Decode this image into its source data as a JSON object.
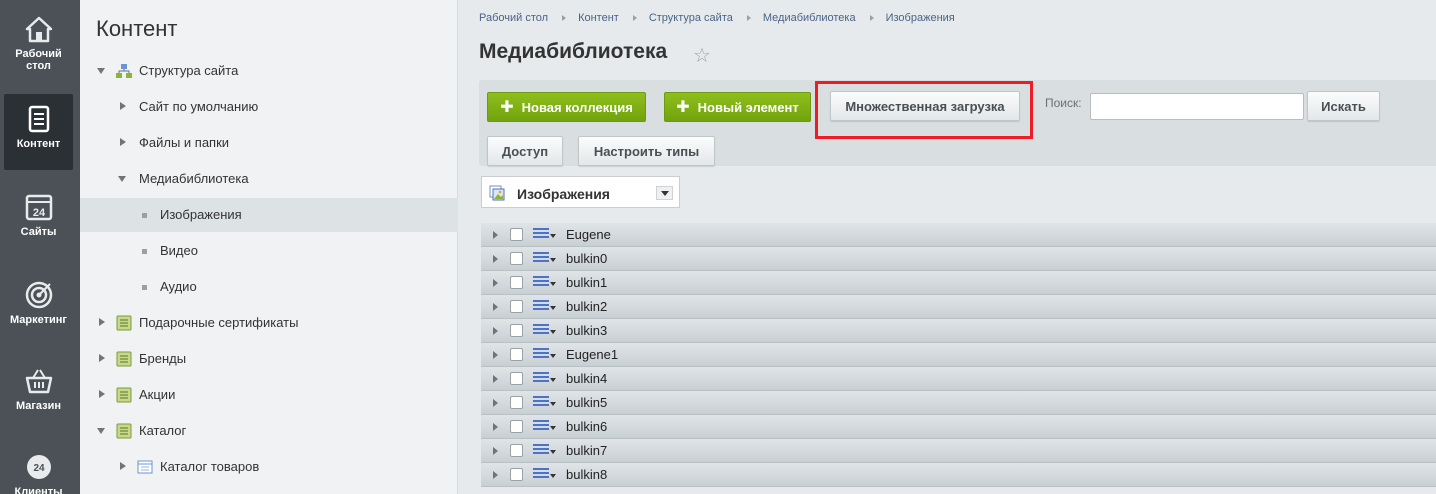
{
  "rail": [
    {
      "label": "Рабочий стол",
      "icon": "home-icon"
    },
    {
      "label": "Контент",
      "icon": "document-icon",
      "active": true
    },
    {
      "label": "Сайты",
      "icon": "calendar-24-icon"
    },
    {
      "label": "Маркетинг",
      "icon": "target-icon"
    },
    {
      "label": "Магазин",
      "icon": "basket-icon"
    },
    {
      "label": "Клиенты",
      "icon": "bitrix24-icon"
    }
  ],
  "tree": {
    "title": "Контент",
    "items": [
      {
        "label": "Структура сайта",
        "level": 0,
        "expanded": true,
        "icon": "sitemap-icon"
      },
      {
        "label": "Сайт по умолчанию",
        "level": 1,
        "expanded": false
      },
      {
        "label": "Файлы и папки",
        "level": 1,
        "expanded": false
      },
      {
        "label": "Медиабиблиотека",
        "level": 1,
        "expanded": true
      },
      {
        "label": "Изображения",
        "level": 2,
        "selected": true
      },
      {
        "label": "Видео",
        "level": 2
      },
      {
        "label": "Аудио",
        "level": 2
      },
      {
        "label": "Подарочные сертификаты",
        "level": 0,
        "expanded": false,
        "icon": "iblock-icon"
      },
      {
        "label": "Бренды",
        "level": 0,
        "expanded": false,
        "icon": "iblock-icon"
      },
      {
        "label": "Акции",
        "level": 0,
        "expanded": false,
        "icon": "iblock-icon"
      },
      {
        "label": "Каталог",
        "level": 0,
        "expanded": true,
        "icon": "iblock-icon"
      },
      {
        "label": "Каталог товаров",
        "level": 1,
        "expanded": false,
        "icon": "catalog-icon"
      }
    ]
  },
  "breadcrumb": [
    "Рабочий стол",
    "Контент",
    "Структура сайта",
    "Медиабиблиотека",
    "Изображения"
  ],
  "page_title": "Медиабиблиотека",
  "toolbar": {
    "new_collection": "Новая коллекция",
    "new_element": "Новый элемент",
    "multi_upload": "Множественная загрузка",
    "search_label": "Поиск:",
    "search_value": "",
    "search_button": "Искать",
    "access": "Доступ",
    "configure_types": "Настроить типы"
  },
  "collection_select": {
    "selected": "Изображения"
  },
  "collections": [
    "Eugene",
    "bulkin0",
    "bulkin1",
    "bulkin2",
    "bulkin3",
    "Eugene1",
    "bulkin4",
    "bulkin5",
    "bulkin6",
    "bulkin7",
    "bulkin8"
  ],
  "colors": {
    "accent_green": "#7fb014",
    "highlight_red": "#ee1c25",
    "rail_bg": "#4b5156"
  }
}
